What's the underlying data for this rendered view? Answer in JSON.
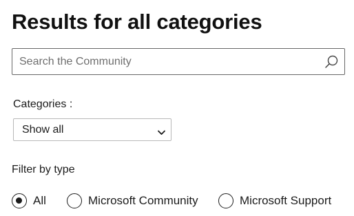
{
  "page_title": "Results for all categories",
  "search": {
    "placeholder": "Search the Community",
    "value": "",
    "icon": "search-icon"
  },
  "categories": {
    "label": "Categories :",
    "selected": "Show all",
    "icon": "chevron-down-icon"
  },
  "filter": {
    "label": "Filter by type",
    "options": [
      {
        "label": "All",
        "selected": true
      },
      {
        "label": "Microsoft Community",
        "selected": false
      },
      {
        "label": "Microsoft Support",
        "selected": false
      }
    ]
  }
}
